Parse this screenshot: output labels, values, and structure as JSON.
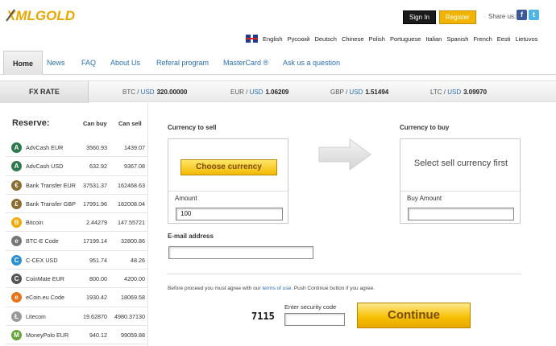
{
  "brand": {
    "name": "XMLGOLD",
    "accent": "#f2b400"
  },
  "header": {
    "signin_label": "Sign In",
    "register_label": "Register",
    "share_label": "Share us:",
    "facebook_icon": "facebook-icon",
    "twitter_icon": "twitter-icon"
  },
  "languages": [
    "English",
    "Русский",
    "Deutsch",
    "Chinese",
    "Polish",
    "Portuguese",
    "Italian",
    "Spanish",
    "French",
    "Eesti",
    "Lietuvos"
  ],
  "nav": {
    "items": [
      {
        "label": "Home",
        "active": true
      },
      {
        "label": "News"
      },
      {
        "label": "FAQ"
      },
      {
        "label": "About Us"
      },
      {
        "label": "Referal program"
      },
      {
        "label": "MasterCard ®"
      },
      {
        "label": "Ask us a question"
      }
    ]
  },
  "fx": {
    "label": "FX RATE",
    "rates": [
      {
        "pair": "BTC",
        "quote": "USD",
        "value": "320.00000"
      },
      {
        "pair": "EUR",
        "quote": "USD",
        "value": "1.06209"
      },
      {
        "pair": "GBP",
        "quote": "USD",
        "value": "1.51494"
      },
      {
        "pair": "LTC",
        "quote": "USD",
        "value": "3.09970"
      }
    ]
  },
  "reserve": {
    "title": "Reserve:",
    "col_buy": "Can buy",
    "col_sell": "Can sell",
    "rows": [
      {
        "name": "AdvCash EUR",
        "can_buy": "3560.93",
        "can_sell": "1439.07",
        "icon": "advcash-icon",
        "color": "#2c7a4b"
      },
      {
        "name": "AdvCash USD",
        "can_buy": "632.92",
        "can_sell": "9367.08",
        "icon": "advcash-icon",
        "color": "#2c7a4b"
      },
      {
        "name": "Bank Transfer EUR",
        "can_buy": "37531.37",
        "can_sell": "162468.63",
        "icon": "euro-icon",
        "color": "#8a6d2f"
      },
      {
        "name": "Bank Transfer GBP",
        "can_buy": "17991.96",
        "can_sell": "182008.04",
        "icon": "pound-icon",
        "color": "#8a6d2f"
      },
      {
        "name": "Bitcoin",
        "can_buy": "2.44279",
        "can_sell": "147.55721",
        "icon": "bitcoin-icon",
        "color": "#f2a900"
      },
      {
        "name": "BTC-E Code",
        "can_buy": "17199.14",
        "can_sell": "32800.86",
        "icon": "btce-icon",
        "color": "#777777"
      },
      {
        "name": "C-CEX USD",
        "can_buy": "951.74",
        "can_sell": "48.26",
        "icon": "ccex-icon",
        "color": "#2a8fd1"
      },
      {
        "name": "CoinMate EUR",
        "can_buy": "800.00",
        "can_sell": "4200.00",
        "icon": "coinmate-icon",
        "color": "#555555"
      },
      {
        "name": "eCoin.eu Code",
        "can_buy": "1930.42",
        "can_sell": "18069.58",
        "icon": "ecoin-icon",
        "color": "#e8731a"
      },
      {
        "name": "Litecoin",
        "can_buy": "19.62870",
        "can_sell": "4980.37130",
        "icon": "litecoin-icon",
        "color": "#9a9a9a"
      },
      {
        "name": "MoneyPolo EUR",
        "can_buy": "940.12",
        "can_sell": "99059.88",
        "icon": "moneypolo-icon",
        "color": "#6aa33a"
      }
    ]
  },
  "form": {
    "sell_label": "Currency to sell",
    "buy_label": "Currency to buy",
    "choose_label": "Choose currency",
    "select_first": "Select sell currency first",
    "amount_label": "Amount",
    "amount_value": "100",
    "buy_amount_label": "Buy Amount",
    "buy_amount_value": "",
    "email_label": "E-mail address",
    "email_value": "",
    "terms_before": "Before proceed you must agree with our",
    "terms_link": "terms of use",
    "terms_after": ". Push Continue button if you agree.",
    "security_label": "Enter security code",
    "captcha": "7115",
    "security_value": "",
    "continue_label": "Continue"
  }
}
